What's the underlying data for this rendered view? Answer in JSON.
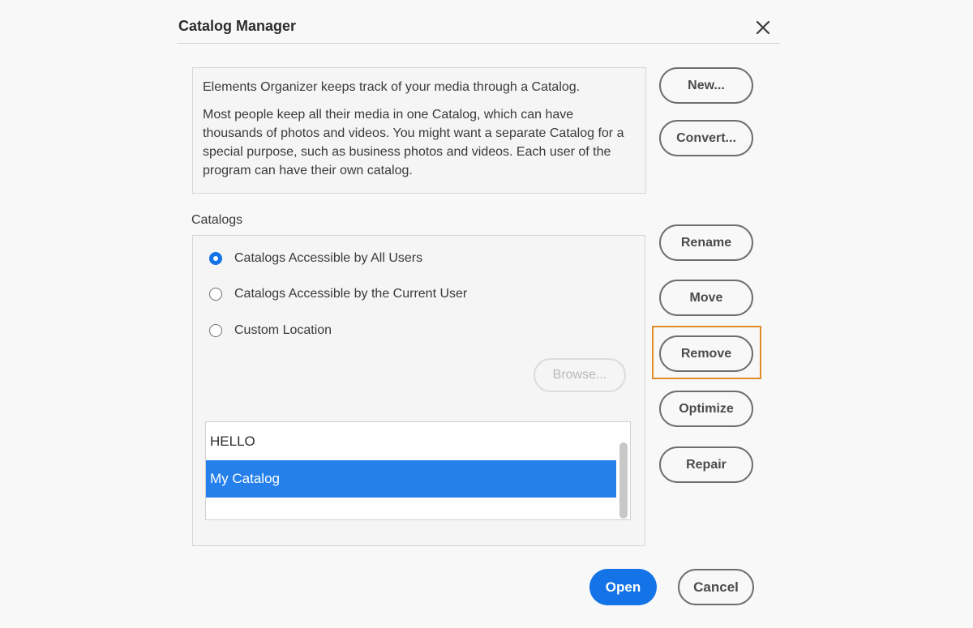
{
  "dialog": {
    "title": "Catalog Manager",
    "close_icon": "close-icon"
  },
  "info": {
    "line1": "Elements Organizer keeps track of your media through a Catalog.",
    "line2": "Most people keep all their media in one Catalog, which can have thousands of photos and videos. You might want a separate Catalog for a special purpose, such as business photos and videos. Each user of the program can have their own catalog."
  },
  "catalogs": {
    "section_label": "Catalogs",
    "options": [
      {
        "label": "Catalogs Accessible by All Users",
        "selected": true
      },
      {
        "label": "Catalogs Accessible by the Current User",
        "selected": false
      },
      {
        "label": "Custom Location",
        "selected": false
      }
    ],
    "browse_label": "Browse...",
    "items": [
      {
        "name": "HELLO",
        "selected": false
      },
      {
        "name": "My Catalog",
        "selected": true
      }
    ]
  },
  "side_buttons": {
    "new": "New...",
    "convert": "Convert...",
    "rename": "Rename",
    "move": "Move",
    "remove": "Remove",
    "optimize": "Optimize",
    "repair": "Repair"
  },
  "footer": {
    "open": "Open",
    "cancel": "Cancel"
  },
  "colors": {
    "accent": "#1473e6",
    "selection": "#2680eb",
    "highlight": "#e08b27"
  }
}
